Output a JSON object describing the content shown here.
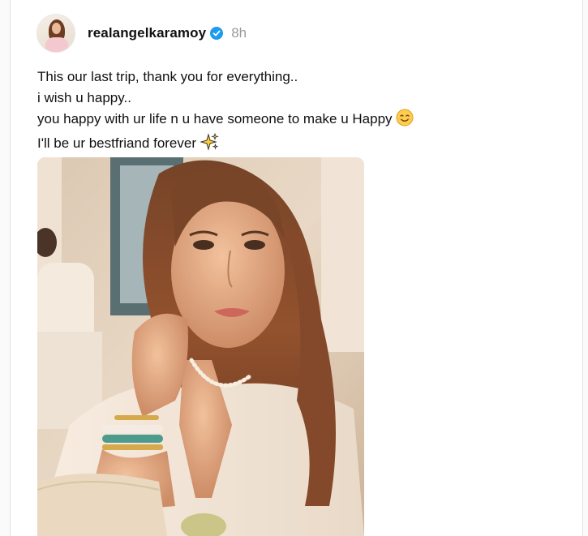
{
  "post": {
    "author": {
      "username": "realangelkaramoy",
      "verified": true,
      "avatar_icon": "profile-photo-avatar"
    },
    "timestamp": "8h",
    "caption": {
      "line1": "This our last trip, thank you for everything..",
      "line2": "i wish u happy..",
      "line3": "you happy with ur life n u have someone to make u Happy",
      "line3_emoji": "smiling-face-icon",
      "line4": "I'll be ur bestfriand forever",
      "line4_emoji": "sparkles-icon"
    },
    "media": {
      "type": "photo",
      "icon": "selfie-photo"
    }
  },
  "colors": {
    "text": "#101010",
    "muted": "#9a9a9a",
    "verified_blue": "#1d9bf0"
  }
}
